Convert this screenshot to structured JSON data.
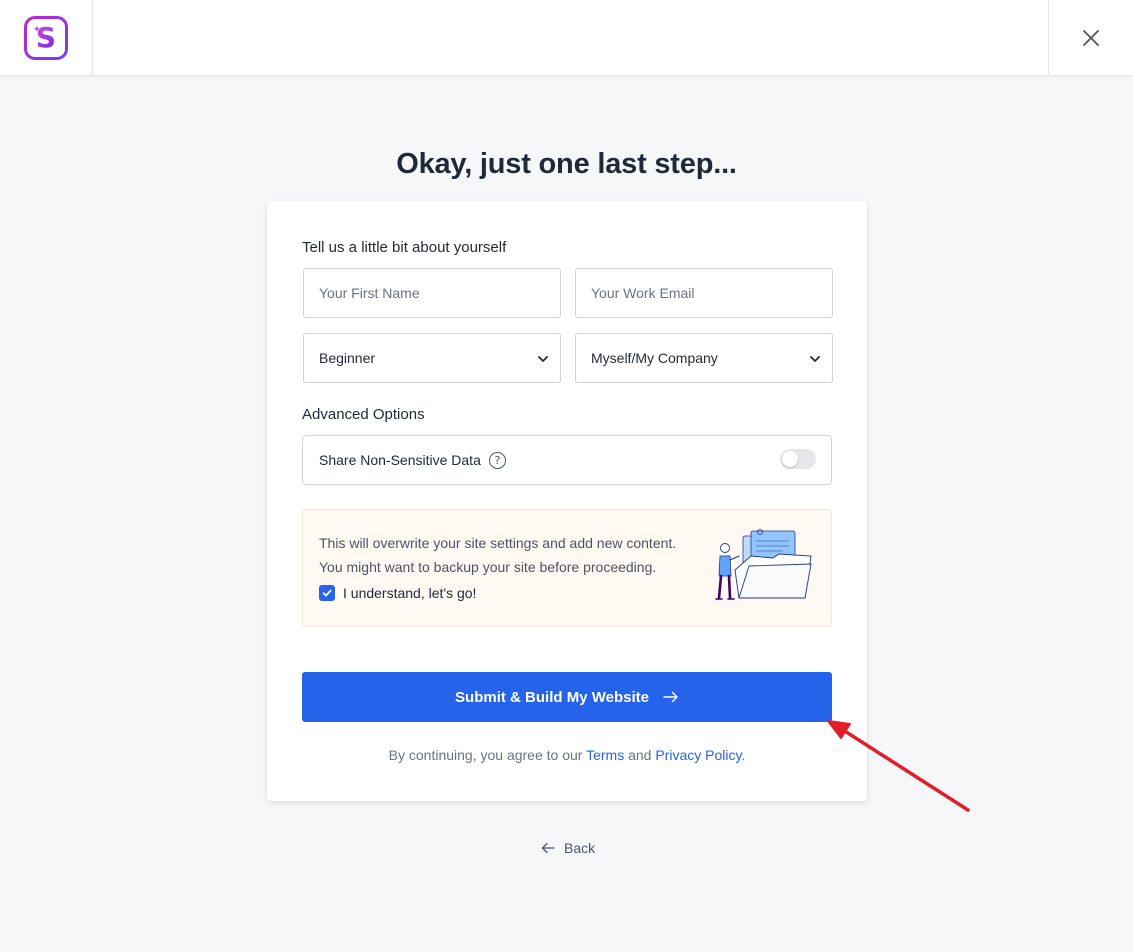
{
  "header": {
    "logo_letter": "S",
    "logo_colors": [
      "#d946ef",
      "#7c3aed"
    ],
    "close_icon": "close-icon"
  },
  "page": {
    "title": "Okay, just one last step..."
  },
  "form": {
    "about_label": "Tell us a little bit about yourself",
    "first_name": {
      "placeholder": "Your First Name",
      "value": ""
    },
    "work_email": {
      "placeholder": "Your Work Email",
      "value": ""
    },
    "experience_select": {
      "selected": "Beginner"
    },
    "site_for_select": {
      "selected": "Myself/My Company"
    },
    "advanced_label": "Advanced Options",
    "share_data": {
      "label": "Share Non-Sensitive Data",
      "enabled": false
    }
  },
  "warning": {
    "line1": "This will overwrite your site settings and add new content.",
    "line2": "You might want to backup your site before proceeding.",
    "confirm_label": "I understand, let's go!",
    "confirm_checked": true
  },
  "actions": {
    "submit_label": "Submit & Build My Website",
    "legal_prefix": "By continuing, you agree to our",
    "terms_label": "Terms",
    "and_text": "and",
    "privacy_label": "Privacy Policy",
    "legal_suffix": ".",
    "back_label": "Back"
  },
  "colors": {
    "primary": "#2563eb",
    "annotation_arrow": "#e11d2a",
    "warning_bg": "#fff8f3"
  }
}
